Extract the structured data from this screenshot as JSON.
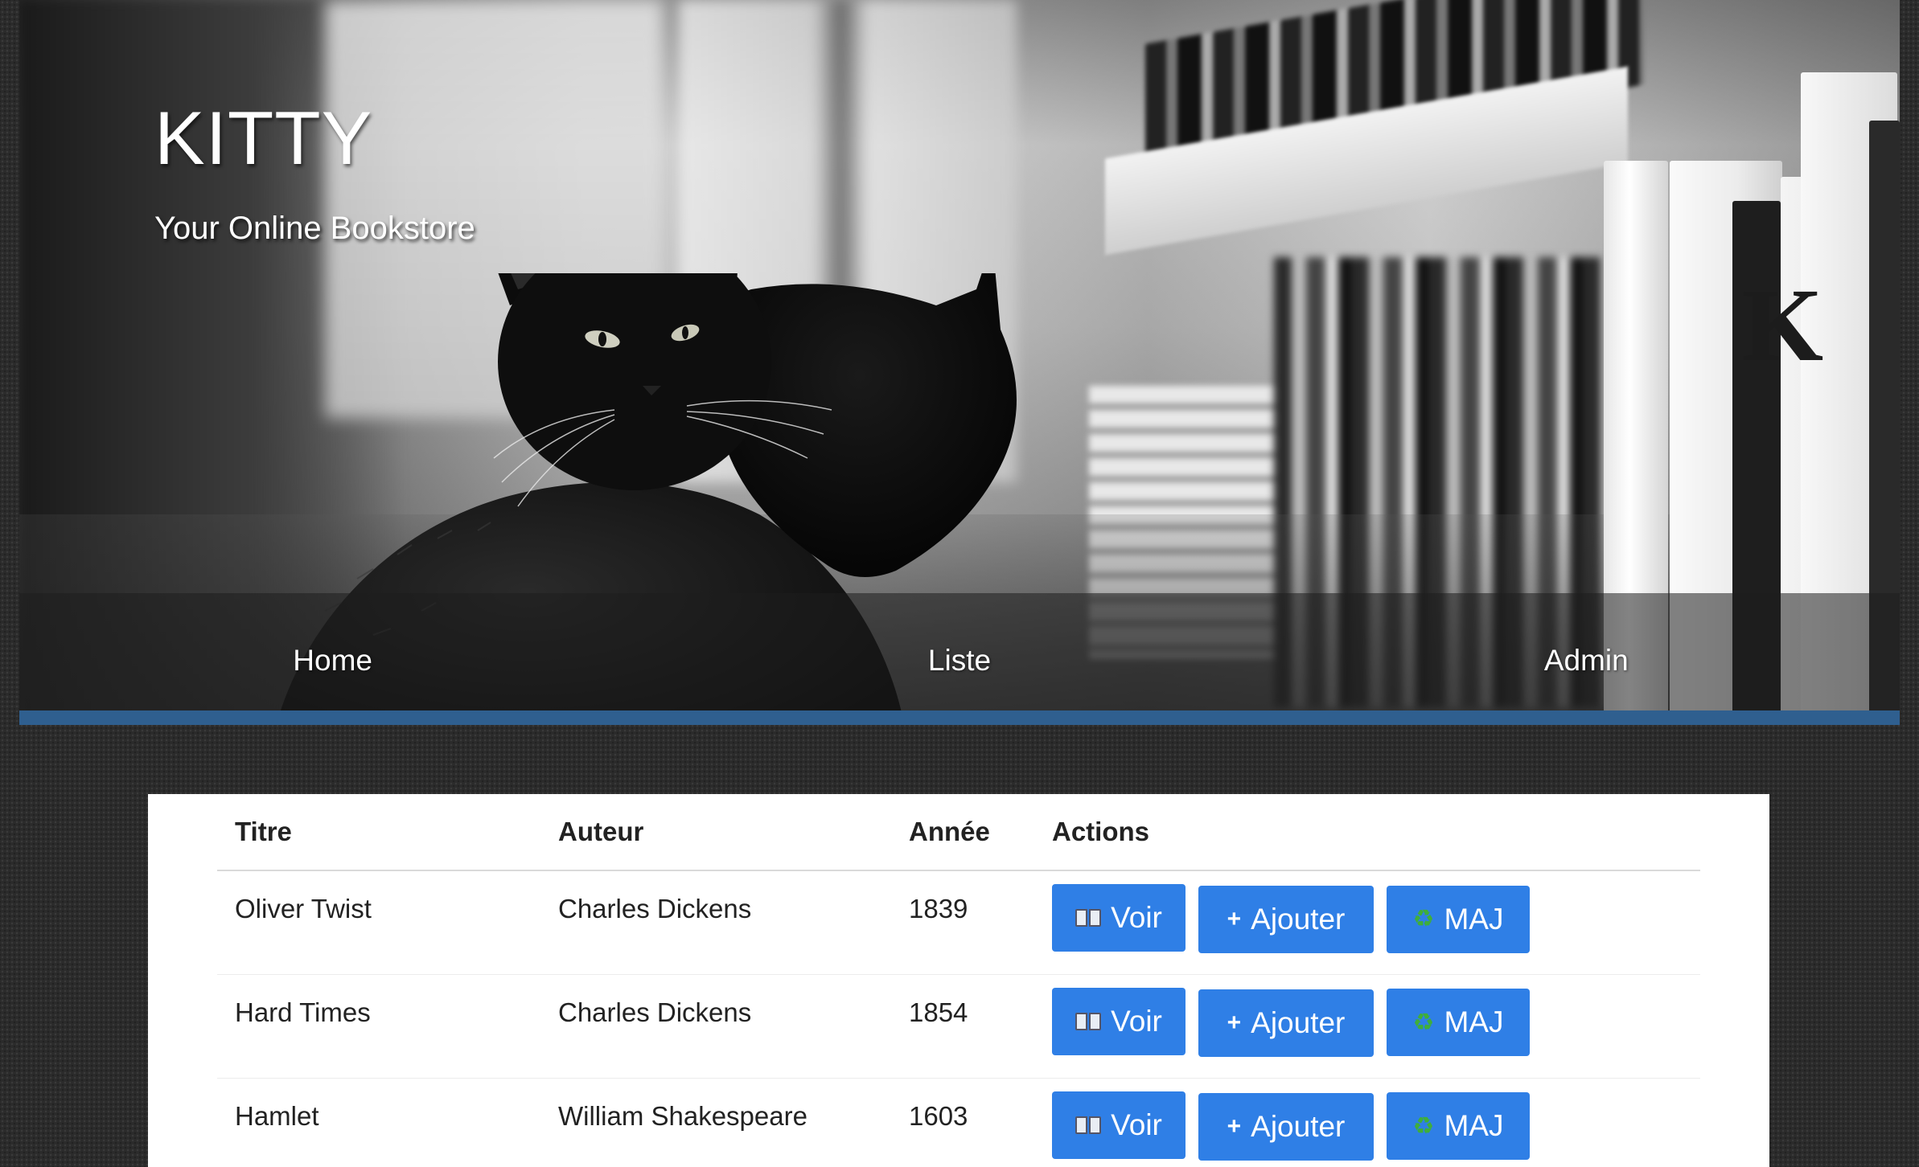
{
  "site": {
    "title": "KITTY",
    "tagline": "Your Online Bookstore"
  },
  "nav": {
    "items": [
      {
        "label": "Home"
      },
      {
        "label": "Liste"
      },
      {
        "label": "Admin"
      }
    ],
    "accent_color": "#2f5f8f"
  },
  "table": {
    "headers": {
      "title": "Titre",
      "author": "Auteur",
      "year": "Année",
      "actions": "Actions"
    },
    "rows": [
      {
        "title": "Oliver Twist",
        "author": "Charles Dickens",
        "year": "1839"
      },
      {
        "title": "Hard Times",
        "author": "Charles Dickens",
        "year": "1854"
      },
      {
        "title": "Hamlet",
        "author": "William Shakespeare",
        "year": "1603"
      }
    ],
    "buttons": {
      "view": {
        "label": "Voir",
        "icon": "open-book-icon"
      },
      "add": {
        "label": "Ajouter",
        "icon": "plus-icon"
      },
      "update": {
        "label": "MAJ",
        "icon": "recycle-icon"
      }
    },
    "button_color": "#2f7fe6"
  }
}
